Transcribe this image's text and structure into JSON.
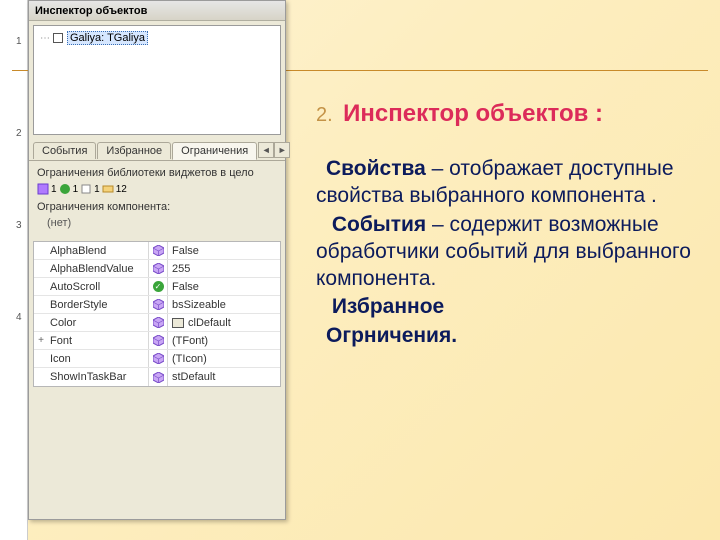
{
  "ruler": {
    "m1": "1",
    "m2": "2",
    "m3": "3",
    "m4": "4"
  },
  "inspector": {
    "title": "Инспектор объектов",
    "tree_item": "Galiya: TGaliya",
    "tabs": [
      "События",
      "Избранное",
      "Ограничения"
    ],
    "lib_label": "Ограничения библиотеки виджетов в цело",
    "counts": {
      "a": "1",
      "b": "1",
      "c": "1",
      "d": "12"
    },
    "comp_label": "Ограничения компонента:",
    "none": "(нет)",
    "rows": [
      {
        "name": "AlphaBlend",
        "icon": "cube",
        "value": "False",
        "expand": ""
      },
      {
        "name": "AlphaBlendValue",
        "icon": "cube",
        "value": "255",
        "expand": ""
      },
      {
        "name": "AutoScroll",
        "icon": "green",
        "value": "False",
        "expand": ""
      },
      {
        "name": "BorderStyle",
        "icon": "cube",
        "value": "bsSizeable",
        "expand": ""
      },
      {
        "name": "Color",
        "icon": "cube",
        "value": "clDefault",
        "expand": "",
        "swatch": true
      },
      {
        "name": "Font",
        "icon": "cube",
        "value": "(TFont)",
        "expand": "+"
      },
      {
        "name": "Icon",
        "icon": "cube",
        "value": "(TIcon)",
        "expand": ""
      },
      {
        "name": "ShowInTaskBar",
        "icon": "cube",
        "value": "stDefault",
        "expand": ""
      }
    ]
  },
  "slide": {
    "num": "2.",
    "title": "Инспектор объектов  :",
    "p1_bold": "Свойства",
    "p1_rest": " – отображает доступные свойства выбранного компонента .",
    "p2_bold": " События",
    "p2_rest": " – содержит возможные обработчики событий для выбранного компонента.",
    "p3": " Избранное",
    "p4": "Огрничения."
  }
}
